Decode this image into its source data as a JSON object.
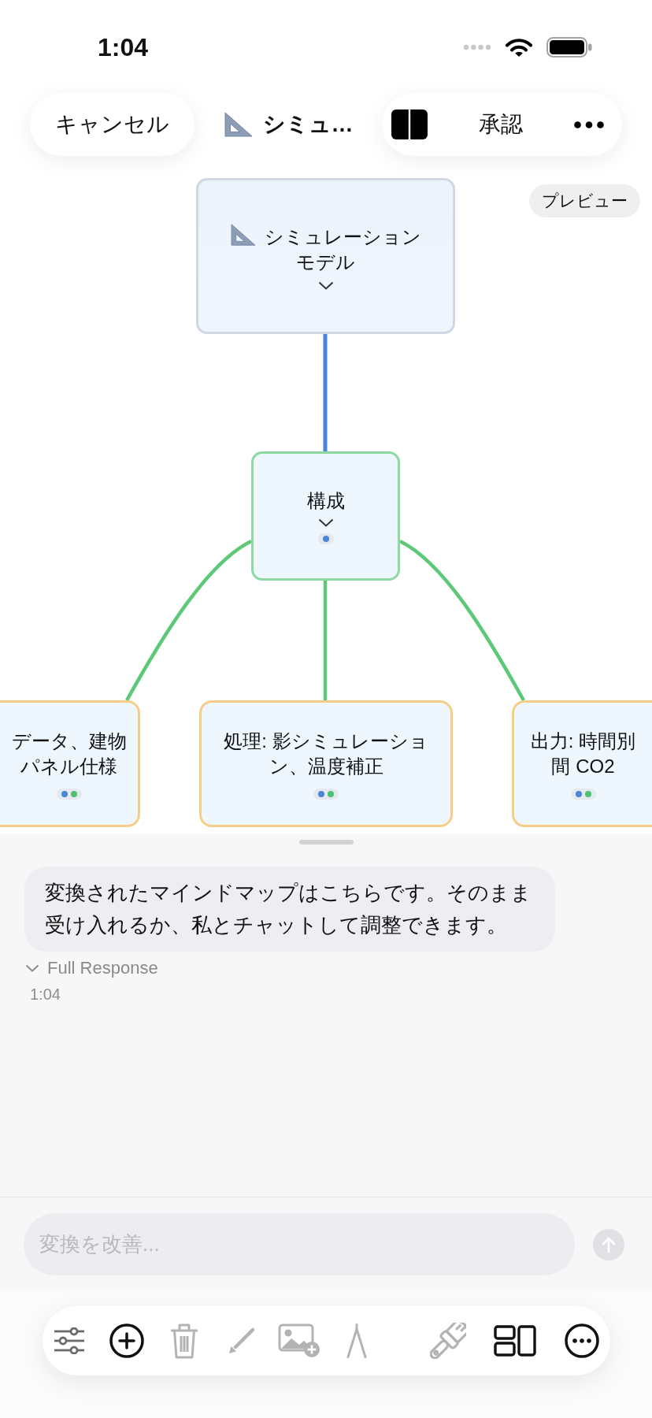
{
  "status_bar": {
    "time": "1:04"
  },
  "top_bar": {
    "cancel": "キャンセル",
    "title": "シミュ…",
    "approve": "承認"
  },
  "canvas": {
    "preview_label": "プレビュー",
    "root": {
      "label": "シミュレーションモデル",
      "expanded": true,
      "children": [
        {
          "label": "構成",
          "expanded": true,
          "markers": [
            {
              "color": "#4a86d8"
            }
          ],
          "children": [
            {
              "lines": [
                "データ、建物",
                "パネル仕様"
              ],
              "markers": [
                {
                  "color": "#4a86d8"
                },
                {
                  "color": "#4cc36e"
                }
              ]
            },
            {
              "label": "処理: 影シミュレーション、温度補正",
              "markers": [
                {
                  "color": "#4a86d8"
                },
                {
                  "color": "#4cc36e"
                }
              ]
            },
            {
              "lines": [
                "出力: 時間別",
                "間 CO2"
              ],
              "markers": [
                {
                  "color": "#4a86d8"
                },
                {
                  "color": "#4cc36e"
                }
              ]
            }
          ]
        }
      ]
    }
  },
  "chat": {
    "messages": [
      {
        "text": "変換されたマインドマップはこちらです。そのまま受け入れるか、私とチャットして調整できます。",
        "toggle": "Full Response",
        "time": "1:04"
      }
    ]
  },
  "composer": {
    "placeholder": "変換を改善...",
    "send_disabled": true
  },
  "toolbar": [
    {
      "kind": "adjust",
      "disabled": false
    },
    {
      "kind": "add",
      "disabled": false
    },
    {
      "kind": "delete",
      "disabled": true
    },
    {
      "kind": "pen",
      "disabled": true
    },
    {
      "kind": "image",
      "disabled": true
    },
    {
      "kind": "compass",
      "disabled": true
    },
    {
      "kind": "brush",
      "disabled": true
    },
    {
      "kind": "layout",
      "disabled": false
    },
    {
      "kind": "more",
      "disabled": false
    }
  ]
}
